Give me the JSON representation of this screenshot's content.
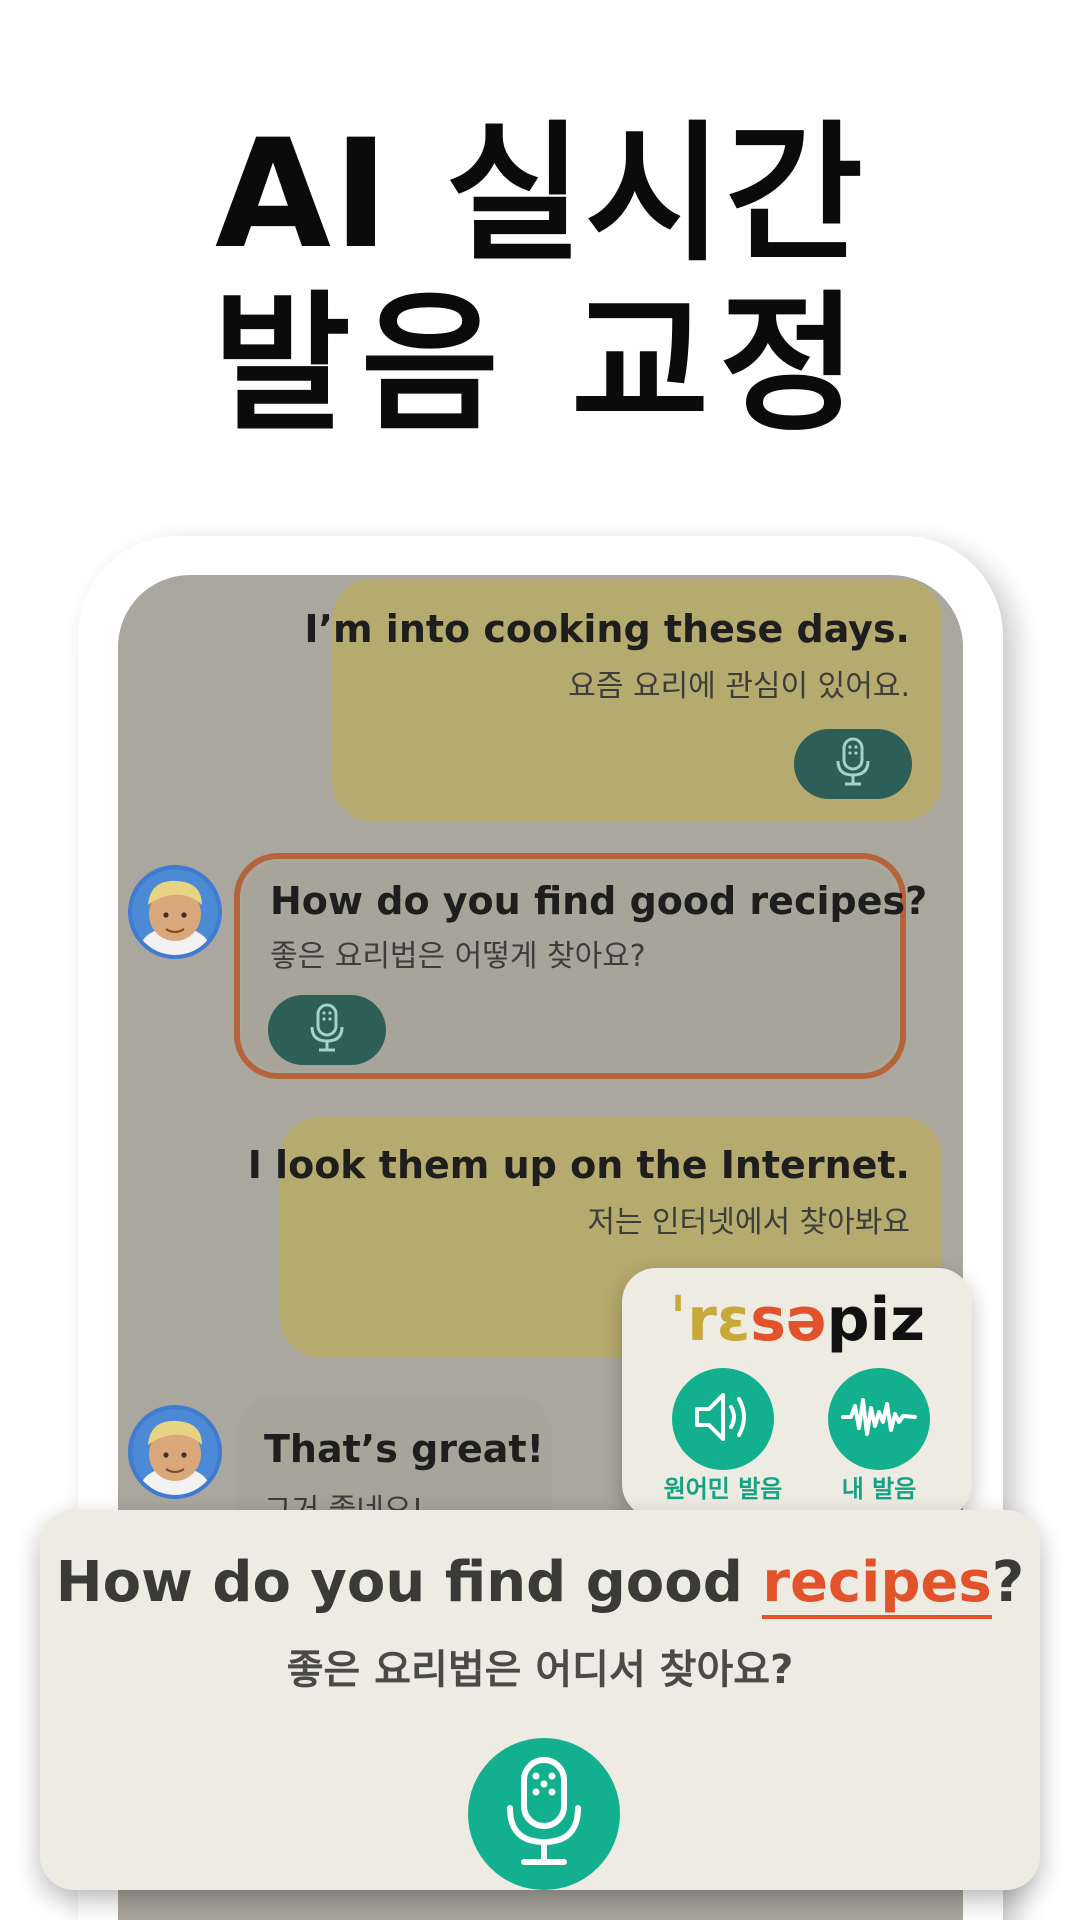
{
  "headline": {
    "line1": "AI 실시간",
    "line2": "발음 교정"
  },
  "chat": [
    {
      "en": "I’m into cooking these days.",
      "ko": "요즘 요리에 관심이 있어요."
    },
    {
      "en": "How do you find good recipes?",
      "ko": "좋은 요리법은 어떻게 찾아요?"
    },
    {
      "en": "I look them up on the Internet.",
      "ko": "저는 인터넷에서 찾아봐요"
    },
    {
      "en": "That’s great!",
      "ko": "그거 좋네요!"
    }
  ],
  "popup": {
    "ipa_seg1": "ˈrɛ",
    "ipa_seg2": "sə",
    "ipa_seg3": "piz",
    "native_label": "원어민 발음",
    "mine_label": "내 발음"
  },
  "card": {
    "en_before": "How do you find good ",
    "en_highlight": "recipes",
    "en_after": "?",
    "ko": "좋은 요리법은 어디서 찾아요?"
  },
  "colors": {
    "accent": "#12b08f",
    "highlight": "#e2522b",
    "user_bubble": "#b6ab6e",
    "mic_pill": "#2d5e58"
  },
  "icons": {
    "mic": "microphone-icon",
    "speaker": "speaker-icon",
    "waveform": "waveform-icon",
    "avatar": "avatar"
  }
}
